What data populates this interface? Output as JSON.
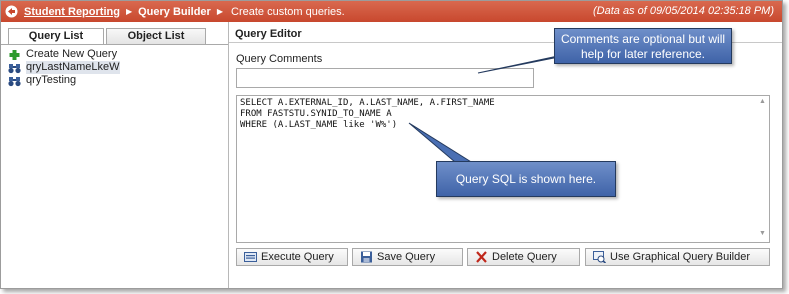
{
  "header": {
    "app_name": "Student Reporting",
    "separator": "▶",
    "current_page": "Query Builder",
    "description": "Create custom queries.",
    "data_as_of": "(Data as of 09/05/2014 02:35:18 PM)"
  },
  "left_panel": {
    "tabs": [
      {
        "label": "Query List",
        "active": true
      },
      {
        "label": "Object List",
        "active": false
      }
    ],
    "items": [
      {
        "label": "Create New Query",
        "icon": "plus-icon"
      },
      {
        "label": "qryLastNameLkeW",
        "icon": "binoculars-icon",
        "selected": true
      },
      {
        "label": "qryTesting",
        "icon": "binoculars-icon"
      }
    ]
  },
  "editor": {
    "title": "Query Editor",
    "comments_label": "Query Comments",
    "comments_value": "",
    "sql": "SELECT A.EXTERNAL_ID, A.LAST_NAME, A.FIRST_NAME\nFROM FASTSTU.SYNID_TO_NAME A\nWHERE (A.LAST_NAME like 'W%')"
  },
  "buttons": {
    "execute": "Execute Query",
    "save": "Save Query",
    "delete": "Delete Query",
    "graphical": "Use Graphical Query Builder"
  },
  "callouts": {
    "comments_note": "Comments are optional but will help for later reference.",
    "sql_note": "Query SQL is shown here."
  },
  "colors": {
    "header_bar": "#c8482e",
    "callout": "#4a6fb3"
  }
}
